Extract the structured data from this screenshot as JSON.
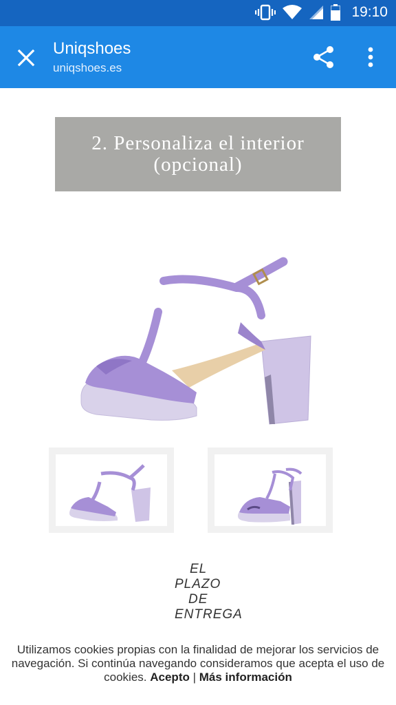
{
  "status_bar": {
    "time": "19:10",
    "icons": [
      "vibrate-icon",
      "wifi-icon",
      "signal-icon",
      "battery-icon"
    ]
  },
  "toolbar": {
    "title": "Uniqshoes",
    "url": "uniqshoes.es",
    "close_icon": "close-icon",
    "share_icon": "share-icon",
    "menu_icon": "more-vert-icon"
  },
  "content": {
    "heading_line1": "2. Personaliza el interior",
    "heading_line2": "(opcional)",
    "plazo_lines": [
      "EL",
      "PLAZO",
      "DE",
      "ENTREGA"
    ]
  },
  "cookie": {
    "text": "Utilizamos cookies propias con la finalidad de mejorar los servicios de navegación. Si continúa navegando consideramos que acepta el uso de cookies.",
    "accept_label": "Acepto",
    "separator": "|",
    "more_label": "Más información"
  },
  "colors": {
    "status_bar": "#1565c0",
    "toolbar": "#1e88e5",
    "heading_bg": "#a9a9a6",
    "shoe_purple": "#a68fd6",
    "heel_lilac": "#cfc4e6"
  }
}
